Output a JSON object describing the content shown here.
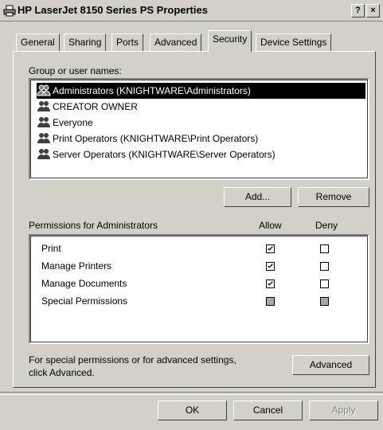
{
  "window": {
    "title": "HP LaserJet 8150 Series PS Properties",
    "help_label": "?",
    "close_label": "×"
  },
  "tabs": [
    {
      "label": "General"
    },
    {
      "label": "Sharing"
    },
    {
      "label": "Ports"
    },
    {
      "label": "Advanced"
    },
    {
      "label": "Security",
      "active": true
    },
    {
      "label": "Device Settings"
    }
  ],
  "groups": {
    "label": "Group or user names:",
    "items": [
      {
        "label": "Administrators (KNIGHTWARE\\Administrators)",
        "selected": true
      },
      {
        "label": "CREATOR OWNER"
      },
      {
        "label": "Everyone"
      },
      {
        "label": "Print Operators (KNIGHTWARE\\Print Operators)"
      },
      {
        "label": "Server Operators (KNIGHTWARE\\Server Operators)"
      }
    ],
    "add_label": "Add...",
    "remove_label": "Remove"
  },
  "permissions": {
    "label": "Permissions for Administrators",
    "allow_header": "Allow",
    "deny_header": "Deny",
    "rows": [
      {
        "label": "Print",
        "allow": "checked",
        "deny": "unchecked"
      },
      {
        "label": "Manage Printers",
        "allow": "checked",
        "deny": "unchecked"
      },
      {
        "label": "Manage Documents",
        "allow": "checked",
        "deny": "unchecked"
      },
      {
        "label": "Special Permissions",
        "allow": "grey",
        "deny": "grey"
      }
    ]
  },
  "advanced": {
    "note": "For special permissions or for advanced settings,",
    "note2": "click Advanced.",
    "button_label": "Advanced"
  },
  "footer": {
    "ok_label": "OK",
    "cancel_label": "Cancel",
    "apply_label": "Apply"
  }
}
